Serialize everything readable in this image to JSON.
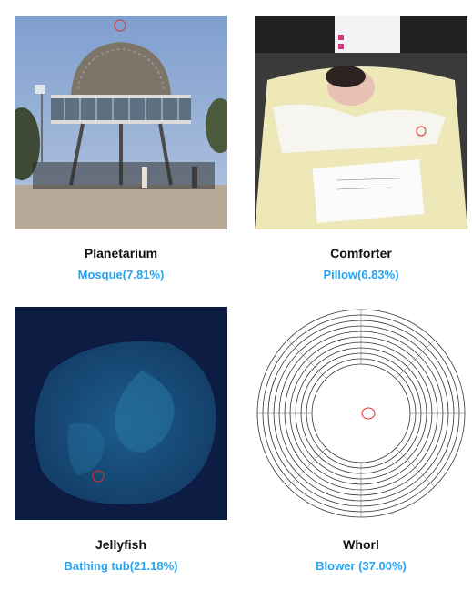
{
  "panels": [
    {
      "label": "Planetarium",
      "prediction": "Mosque(7.81%)"
    },
    {
      "label": "Comforter",
      "prediction": "Pillow(6.83%)"
    },
    {
      "label": "Jellyfish",
      "prediction": "Bathing tub(21.18%)"
    },
    {
      "label": "Whorl",
      "prediction": "Blower (37.00%)"
    }
  ],
  "colors": {
    "prediction_text": "#27a3f1",
    "label_text": "#111111",
    "marker": "#e0302a"
  },
  "icons": [
    "planetarium-photo",
    "baby-comforter-photo",
    "jellyfish-photo",
    "whorl-pattern",
    "perturbation-marker-circle"
  ]
}
